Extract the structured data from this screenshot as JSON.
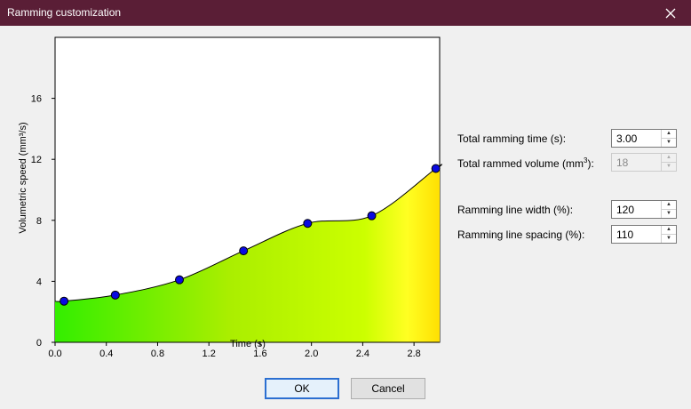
{
  "window": {
    "title": "Ramming customization",
    "close_icon": "close-icon"
  },
  "chart_data": {
    "type": "area",
    "xlabel": "Time (s)",
    "ylabel": "Volumetric speed (mm³/s)",
    "xlim": [
      0,
      3.0
    ],
    "ylim": [
      0,
      20
    ],
    "xticks": [
      "0.0",
      "0.4",
      "0.8",
      "1.2",
      "1.6",
      "2.0",
      "2.4",
      "2.8"
    ],
    "xtick_values": [
      0,
      0.4,
      0.8,
      1.2,
      1.6,
      2.0,
      2.4,
      2.8
    ],
    "yticks": [
      "0",
      "4",
      "8",
      "12",
      "16"
    ],
    "ytick_values": [
      0,
      4,
      8,
      12,
      16
    ],
    "points_x": [
      0.07,
      0.47,
      0.97,
      1.47,
      1.97,
      2.47,
      2.97
    ],
    "points_y": [
      2.7,
      3.1,
      4.1,
      6.0,
      7.8,
      8.3,
      11.4
    ],
    "fill_gradient": [
      "#33ee00",
      "#aaee00",
      "#ccff00",
      "#ffff22",
      "#ffdd00"
    ],
    "point_color": "#0a0ae0"
  },
  "settings": {
    "ramming_time": {
      "label": "Total ramming time (s):",
      "value": "3.00"
    },
    "rammed_volume": {
      "label_main": "Total rammed volume (mm",
      "label_sup": "3",
      "label_end": "):",
      "value": "18"
    },
    "line_width": {
      "label": "Ramming line width (%):",
      "value": "120"
    },
    "line_spacing": {
      "label": "Ramming line spacing (%):",
      "value": "110"
    }
  },
  "buttons": {
    "ok": "OK",
    "cancel": "Cancel"
  }
}
